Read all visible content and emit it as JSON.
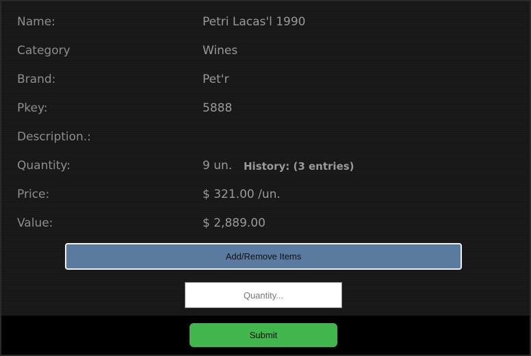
{
  "product": {
    "name": {
      "label": "Name:",
      "value": "Petri Lacas'l 1990"
    },
    "category": {
      "label": "Category",
      "value": "Wines"
    },
    "brand": {
      "label": "Brand:",
      "value": "Pet'r"
    },
    "pkey": {
      "label": "Pkey:",
      "value": "5888"
    },
    "description": {
      "label": "Description.:",
      "value": ""
    },
    "quantity": {
      "label": "Quantity:",
      "value": "9 un.",
      "history_link": "History: (3 entries)"
    },
    "price": {
      "label": "Price:",
      "value": "$ 321.00 /un."
    },
    "total_value": {
      "label": "Value:",
      "value": "$ 2,889.00"
    }
  },
  "actions": {
    "add_remove_label": "Add/Remove Items",
    "quantity_placeholder": "Quantity...",
    "submit_label": "Submit"
  },
  "colors": {
    "add_remove_button": "#5a7aa0",
    "submit_button": "#41b64c",
    "background": "#171717"
  }
}
